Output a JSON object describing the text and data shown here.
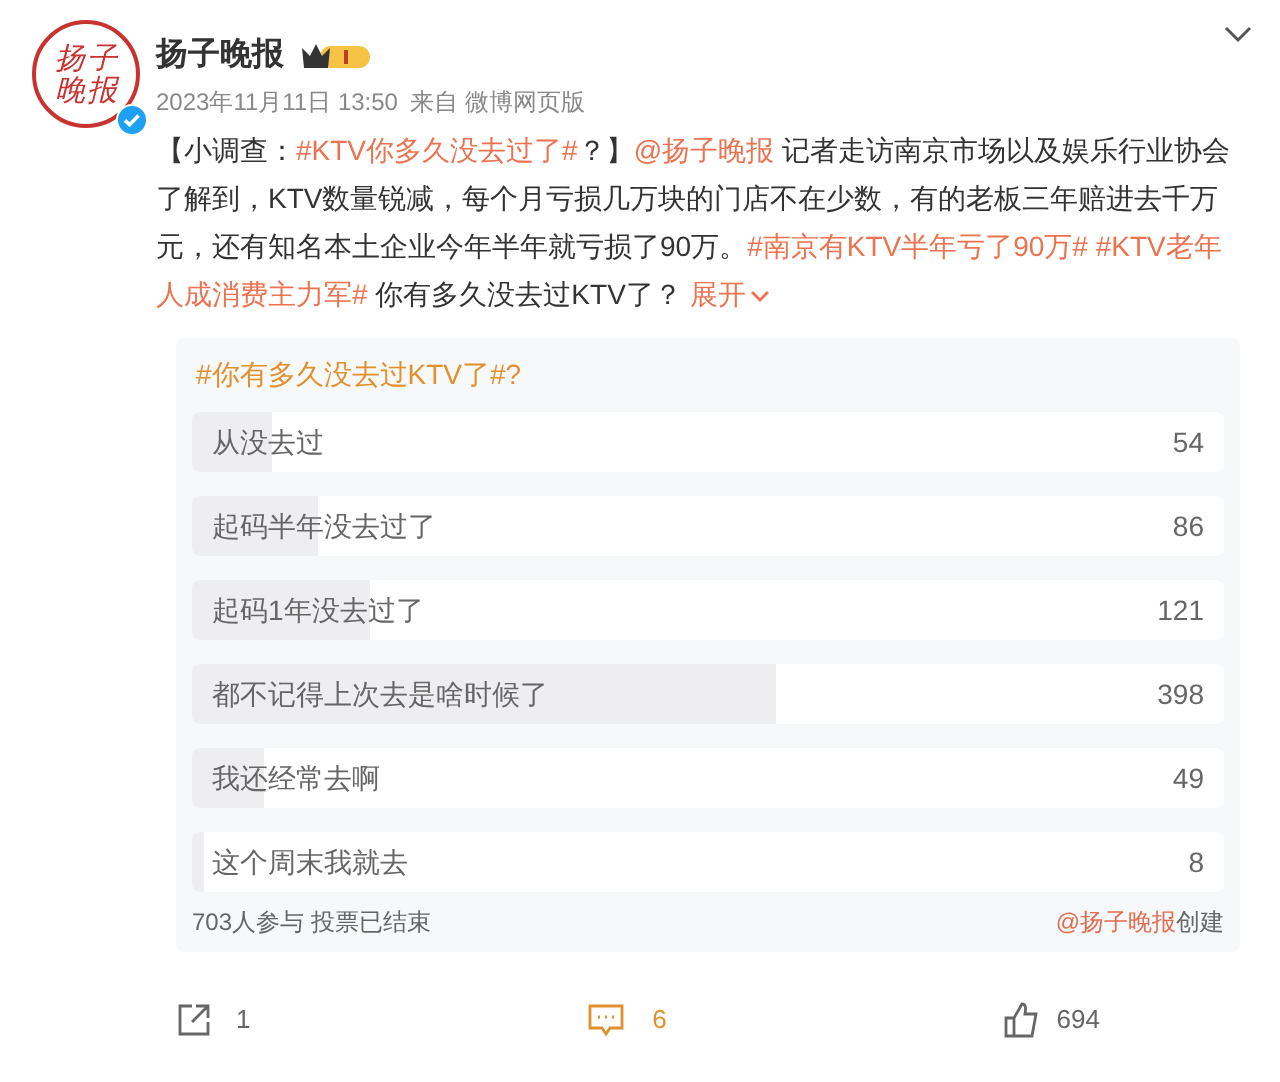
{
  "post": {
    "avatar_text": "扬子晚报",
    "verified": true,
    "author": "扬子晚报",
    "time": "2023年11月11日 13:50",
    "source": "来自 微博网页版",
    "body": [
      {
        "kind": "text",
        "text": "【小调查："
      },
      {
        "kind": "topic",
        "text": "#KTV你多久没去过了#"
      },
      {
        "kind": "text",
        "text": "？】"
      },
      {
        "kind": "mention",
        "text": "@扬子晚报"
      },
      {
        "kind": "text",
        "text": " 记者走访南京市场以及娱乐行业协会了解到，KTV数量锐减，每个月亏损几万块的门店不在少数，有的老板三年赔进去千万元，还有知名本土企业今年半年就亏损了90万。"
      },
      {
        "kind": "topic",
        "text": "#南京有KTV半年亏了90万# "
      },
      {
        "kind": "topic",
        "text": "#KTV老年人成消费主力军#"
      },
      {
        "kind": "text",
        "text": " 你有多久没去过KTV了？ "
      },
      {
        "kind": "expand",
        "text": "展开"
      }
    ]
  },
  "poll": {
    "title": "#你有多久没去过KTV了#?",
    "options": [
      {
        "label": "从没去过",
        "count": "54",
        "level": 0.077
      },
      {
        "label": "起码半年没去过了",
        "count": "86",
        "level": 0.122
      },
      {
        "label": "起码1年没去过了",
        "count": "121",
        "level": 0.172
      },
      {
        "label": "都不记得上次去是啥时候了",
        "count": "398",
        "level": 0.566
      },
      {
        "label": "我还经常去啊",
        "count": "49",
        "level": 0.07
      },
      {
        "label": "这个周末我就去",
        "count": "8",
        "level": 0.011
      }
    ],
    "summary": "703人参与 投票已结束",
    "creator": "@扬子晚报",
    "creator_suffix": "创建"
  },
  "actions": {
    "share": "1",
    "comment": "6",
    "like": "694"
  }
}
